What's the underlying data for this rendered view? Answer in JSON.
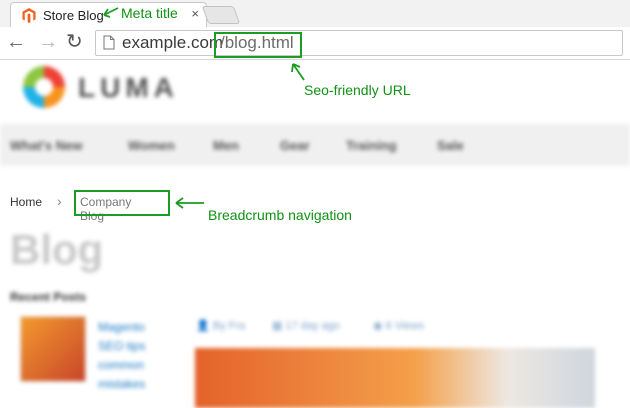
{
  "browser": {
    "tab_title": "Store Blog",
    "tab_close": "×",
    "back": "←",
    "forward": "→",
    "reload": "↻",
    "url_host": "example.com",
    "url_path": "/blog.html"
  },
  "page": {
    "logo_text": "LUMA",
    "menu": [
      "What's New",
      "Women",
      "Men",
      "Gear",
      "Training",
      "Sale"
    ],
    "breadcrumb": {
      "home": "Home",
      "separator": "›",
      "current": "Company Blog"
    },
    "title": "Blog",
    "recent_posts_heading": "Recent Posts",
    "post_link_lines": [
      "Magento",
      "SEO tips",
      "common",
      "mistakes"
    ],
    "post_meta": [
      "By Fra",
      "17 day ago",
      "6 Views"
    ]
  },
  "annotations": {
    "meta_title": "Meta title",
    "seo_url": "Seo-friendly URL",
    "breadcrumb_nav": "Breadcrumb navigation"
  },
  "colors": {
    "annotation": "#1d9c23",
    "link": "#1979c3",
    "magento_logo": "#f26322"
  }
}
